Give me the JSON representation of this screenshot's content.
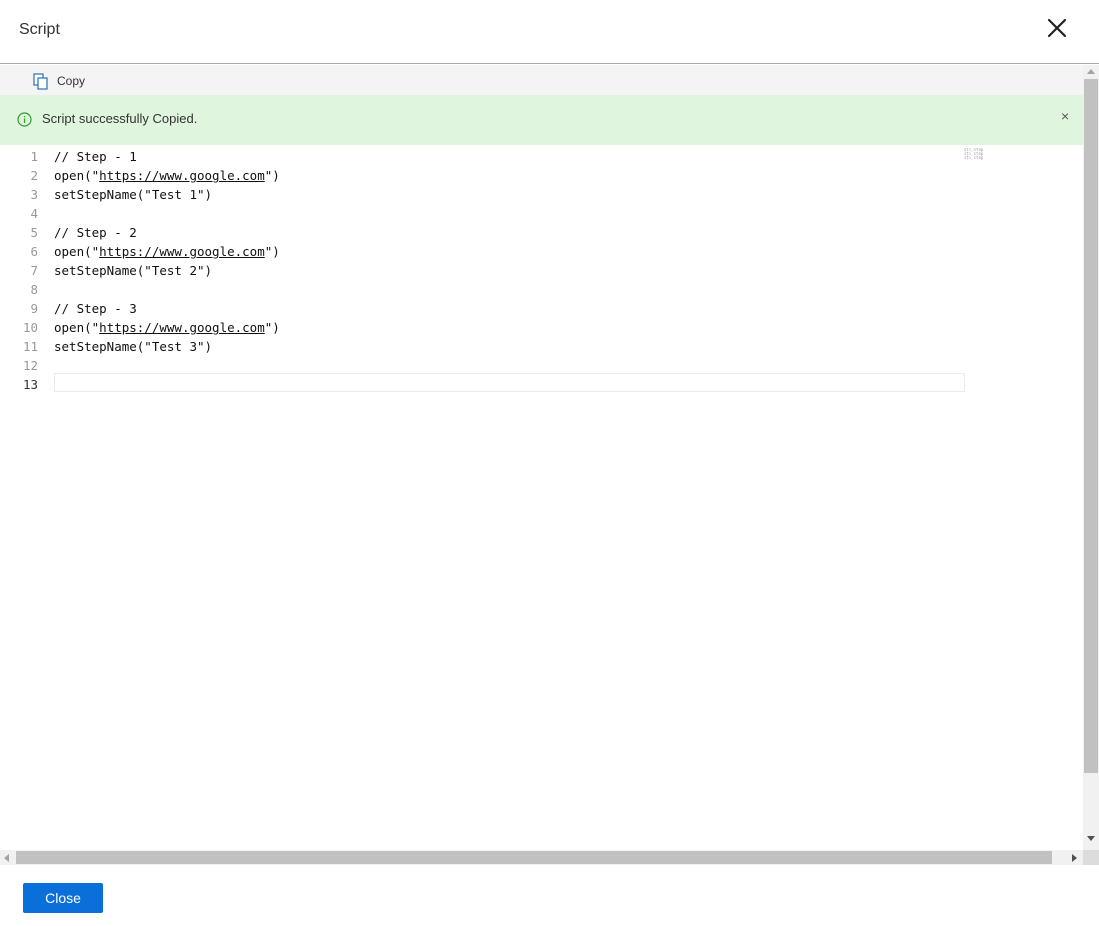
{
  "dialog": {
    "title": "Script",
    "close_icon": "close-icon"
  },
  "toolbar": {
    "copy_label": "Copy",
    "copy_icon": "copy-icon"
  },
  "alert": {
    "message": "Script successfully Copied.",
    "icon": "info-circle-icon",
    "dismiss": "×",
    "background": "#dff5de",
    "icon_color": "#2e9e2e"
  },
  "editor": {
    "lines": [
      {
        "num": "1",
        "text": "// Step - 1"
      },
      {
        "num": "2",
        "pre": "open(\"",
        "link": "https://www.google.com",
        "post": "\")"
      },
      {
        "num": "3",
        "text": "setStepName(\"Test 1\")"
      },
      {
        "num": "4",
        "text": ""
      },
      {
        "num": "5",
        "text": "// Step - 2"
      },
      {
        "num": "6",
        "pre": "open(\"",
        "link": "https://www.google.com",
        "post": "\")"
      },
      {
        "num": "7",
        "text": "setStepName(\"Test 2\")"
      },
      {
        "num": "8",
        "text": ""
      },
      {
        "num": "9",
        "text": "// Step - 3"
      },
      {
        "num": "10",
        "pre": "open(\"",
        "link": "https://www.google.com",
        "post": "\")"
      },
      {
        "num": "11",
        "text": "setStepName(\"Test 3\")"
      },
      {
        "num": "12",
        "text": ""
      },
      {
        "num": "13",
        "text": ""
      }
    ],
    "active_line": "13"
  },
  "footer": {
    "close_label": "Close",
    "accent": "#0b6fd9"
  }
}
